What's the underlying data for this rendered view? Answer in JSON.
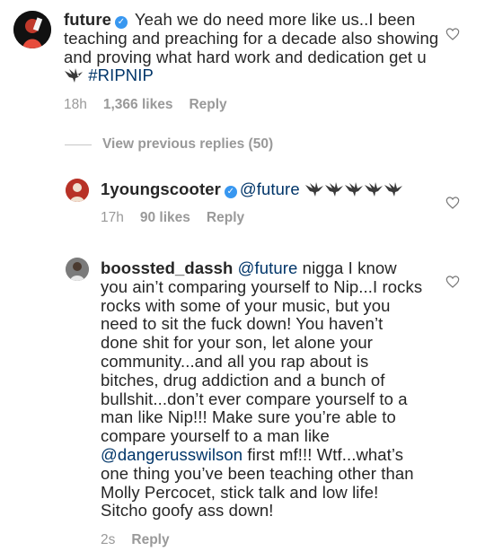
{
  "comments": [
    {
      "username": "future",
      "text_line1": " Yeah we do need more like us..I been",
      "text_rest": "teaching and preaching for a decade also showing and proving what hard work and dedication get u ",
      "hashtag": "#RIPNIP",
      "time": "18h",
      "likes": "1,366 likes",
      "reply": "Reply"
    },
    {
      "username": "1youngscooter",
      "mention": "@future",
      "time": "17h",
      "likes": "90 likes",
      "reply": "Reply"
    },
    {
      "username": "boossted_dassh",
      "mention": "@future",
      "text_part1": " nigga I know you ain’t comparing yourself to Nip...I rocks rocks with some of your music, but you need to sit the fuck down! You haven’t done shit for your son, let alone your community...and all you rap about is bitches, drug addiction and a bunch of bullshit...don’t ever compare yourself to a man like Nip!!! Make sure you’re able to compare yourself to a man like ",
      "mention2": "@dangerusswilson",
      "text_part2": " first mf!!! Wtf...what’s one thing you’ve been teaching other than Molly Percocet, stick talk and low life! Sitcho goofy ass down!",
      "time": "2s",
      "reply": "Reply"
    }
  ],
  "view_previous": "View previous replies (50)",
  "icons": {
    "heart": "heart-outline-icon",
    "verified": "verified-badge-icon",
    "eagle": "eagle-emoji-icon"
  },
  "colors": {
    "text": "#262626",
    "meta": "#999999",
    "link": "#003569",
    "verified": "#3897f0"
  }
}
